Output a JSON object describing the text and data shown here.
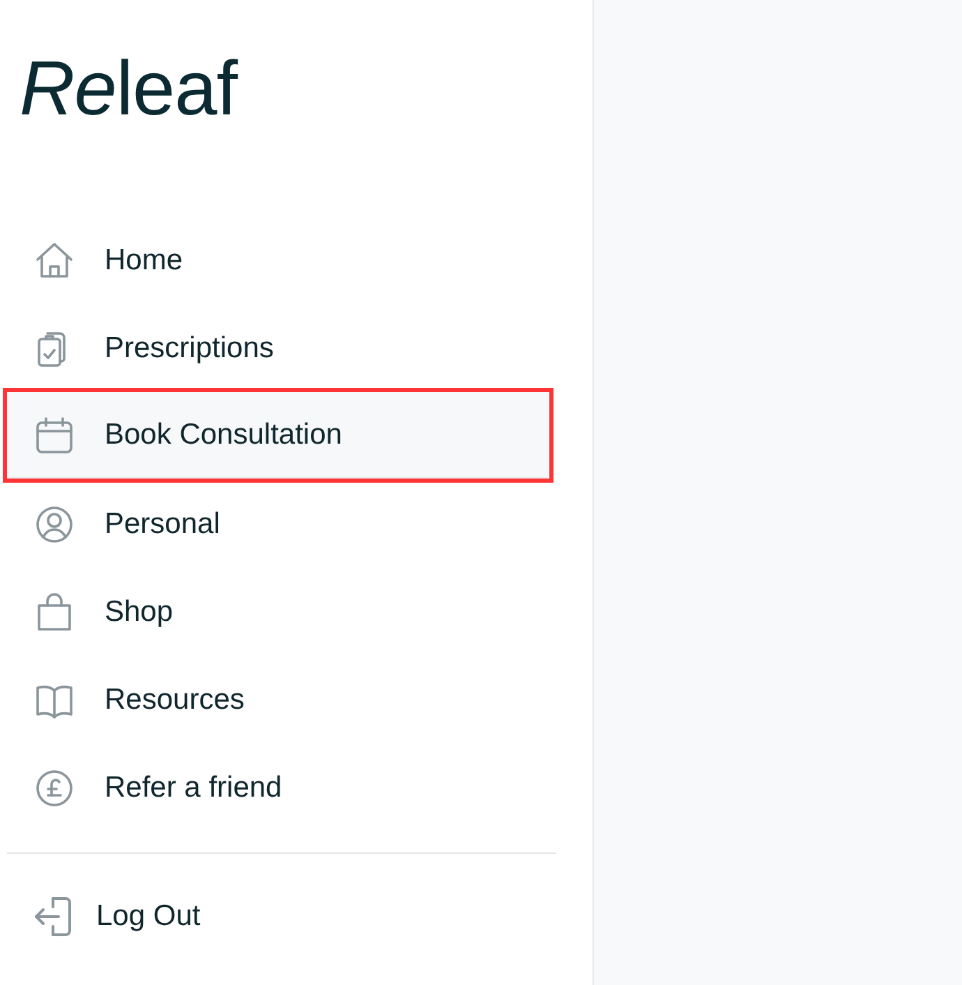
{
  "logo": {
    "parts": [
      {
        "text": "Re",
        "italic": true
      },
      {
        "text": "leaf",
        "italic": false
      }
    ]
  },
  "nav": [
    {
      "label": "Home",
      "selected": false,
      "highlighted": false
    },
    {
      "label": "Prescriptions",
      "selected": false,
      "highlighted": false
    },
    {
      "label": "Book Consultation",
      "selected": true,
      "highlighted": true
    },
    {
      "label": "Personal",
      "selected": false,
      "highlighted": false
    },
    {
      "label": "Shop",
      "selected": false,
      "highlighted": false
    },
    {
      "label": "Resources",
      "selected": false,
      "highlighted": false
    },
    {
      "label": "Refer a friend",
      "selected": false,
      "highlighted": false
    }
  ],
  "logout": {
    "label": "Log Out"
  }
}
